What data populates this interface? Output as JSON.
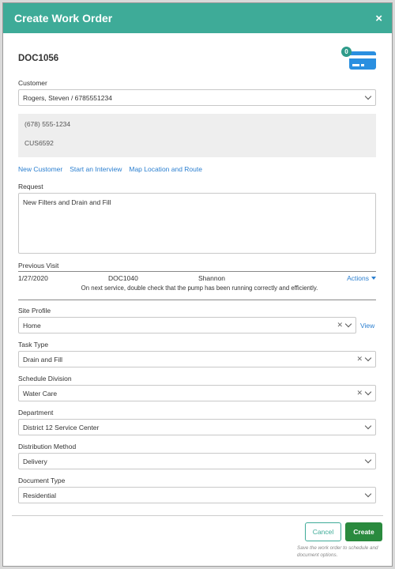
{
  "modal": {
    "title": "Create Work Order",
    "close_label": "×"
  },
  "doc": {
    "id": "DOC1056",
    "card_badge": "0"
  },
  "customer": {
    "label": "Customer",
    "value": "Rogers, Steven / 6785551234",
    "phone": "(678) 555-1234",
    "code": "CUS6592"
  },
  "links": {
    "new_customer": "New Customer",
    "interview": "Start an Interview",
    "map": "Map Location and Route"
  },
  "request": {
    "label": "Request",
    "value": "New Filters and Drain and Fill"
  },
  "previous_visit": {
    "label": "Previous Visit",
    "date": "1/27/2020",
    "doc": "DOC1040",
    "tech": "Shannon",
    "actions_label": "Actions",
    "note": "On next service, double check that the pump has been running correctly and efficiently."
  },
  "site_profile": {
    "label": "Site Profile",
    "value": "Home",
    "view_label": "View"
  },
  "task_type": {
    "label": "Task Type",
    "value": "Drain and Fill"
  },
  "schedule_division": {
    "label": "Schedule Division",
    "value": "Water Care"
  },
  "department": {
    "label": "Department",
    "value": "District 12 Service Center"
  },
  "distribution_method": {
    "label": "Distribution Method",
    "value": "Delivery"
  },
  "document_type": {
    "label": "Document Type",
    "value": "Residential"
  },
  "footer": {
    "cancel_label": "Cancel",
    "create_label": "Create",
    "hint": "Save the work order to schedule and document options."
  },
  "colors": {
    "header": "#3eab98",
    "link": "#2b7fd0",
    "create": "#2a8a3e",
    "card": "#2a8fe0"
  }
}
